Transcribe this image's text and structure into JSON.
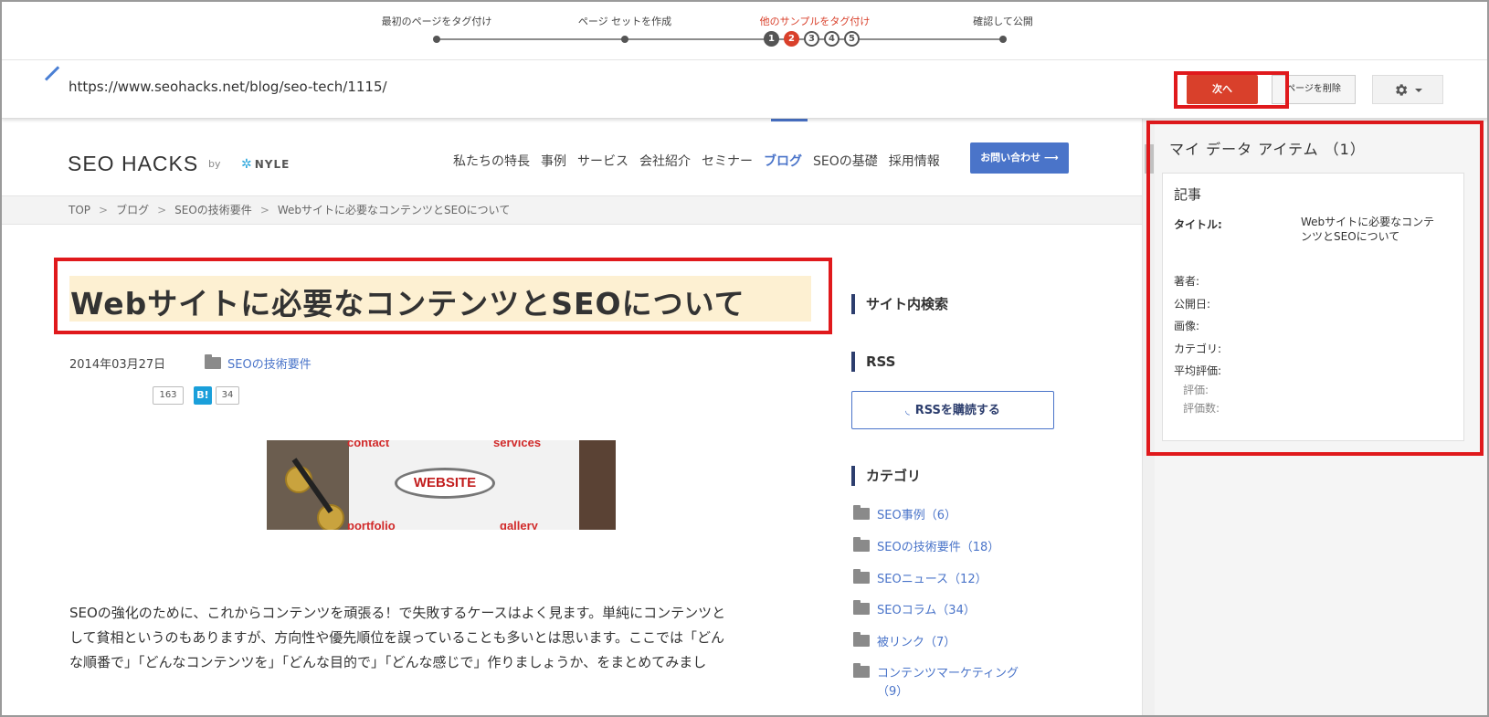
{
  "stepper": {
    "steps": [
      "最初のページをタグ付け",
      "ページ セットを作成",
      "他のサンプルをタグ付け",
      "確認して公開"
    ],
    "numbers": [
      "1",
      "2",
      "3",
      "4",
      "5"
    ],
    "active_step": 3,
    "current_number": 2
  },
  "toolbar": {
    "url": "https://www.seohacks.net/blog/seo-tech/1115/",
    "next_label": "次へ",
    "delete_label": "ページを削除",
    "settings_icon": "gear-icon"
  },
  "site": {
    "logo": "SEO HACKS",
    "by": "by",
    "brand": "NYLE",
    "nav": [
      "私たちの特長",
      "事例",
      "サービス",
      "会社紹介",
      "セミナー",
      "ブログ",
      "SEOの基礎",
      "採用情報"
    ],
    "active_nav": "ブログ",
    "contact": "お問い合わせ",
    "breadcrumb": [
      "TOP",
      "ブログ",
      "SEOの技術要件",
      "Webサイトに必要なコンテンツとSEOについて"
    ]
  },
  "article": {
    "title": "Webサイトに必要なコンテンツとSEOについて",
    "date": "2014年03月27日",
    "category": "SEOの技術要件",
    "like_count": "163",
    "hatena_badge": "B!",
    "hatena_count": "34",
    "image_words": [
      "contact",
      "services",
      "WEBSITE",
      "portfolio",
      "gallery"
    ],
    "body_lines": [
      "SEOの強化のために、これからコンテンツを頑張る！で失敗するケースはよく見ます。単純にコンテンツと",
      "して貧相というのもありますが、方向性や優先順位を誤っていることも多いとは思います。ここでは「どん",
      "な順番で」「どんなコンテンツを」「どんな目的で」「どんな感じで」作りましょうか、をまとめてみまし"
    ]
  },
  "sidebar": {
    "search_heading": "サイト内検索",
    "rss_heading": "RSS",
    "rss_button": "RSSを購読する",
    "category_heading": "カテゴリ",
    "categories": [
      "SEO事例（6）",
      "SEOの技術要件（18）",
      "SEOニュース（12）",
      "SEOコラム（34）",
      "被リンク（7）",
      "コンテンツマーケティング",
      "（9）"
    ]
  },
  "data_panel": {
    "title": "マイ データ アイテム （1）",
    "card_heading": "記事",
    "title_label": "タイトル:",
    "title_value": "Webサイトに必要なコンテンツとSEOについて",
    "fields": [
      "著者:",
      "公開日:",
      "画像:",
      "カテゴリ:",
      "平均評価:"
    ],
    "subfields": [
      "評価:",
      "評価数:"
    ]
  },
  "colors": {
    "accent_red": "#d9402b",
    "highlight_border": "#e0191c",
    "site_blue": "#4a74c9",
    "title_highlight": "#fdf0d2"
  }
}
